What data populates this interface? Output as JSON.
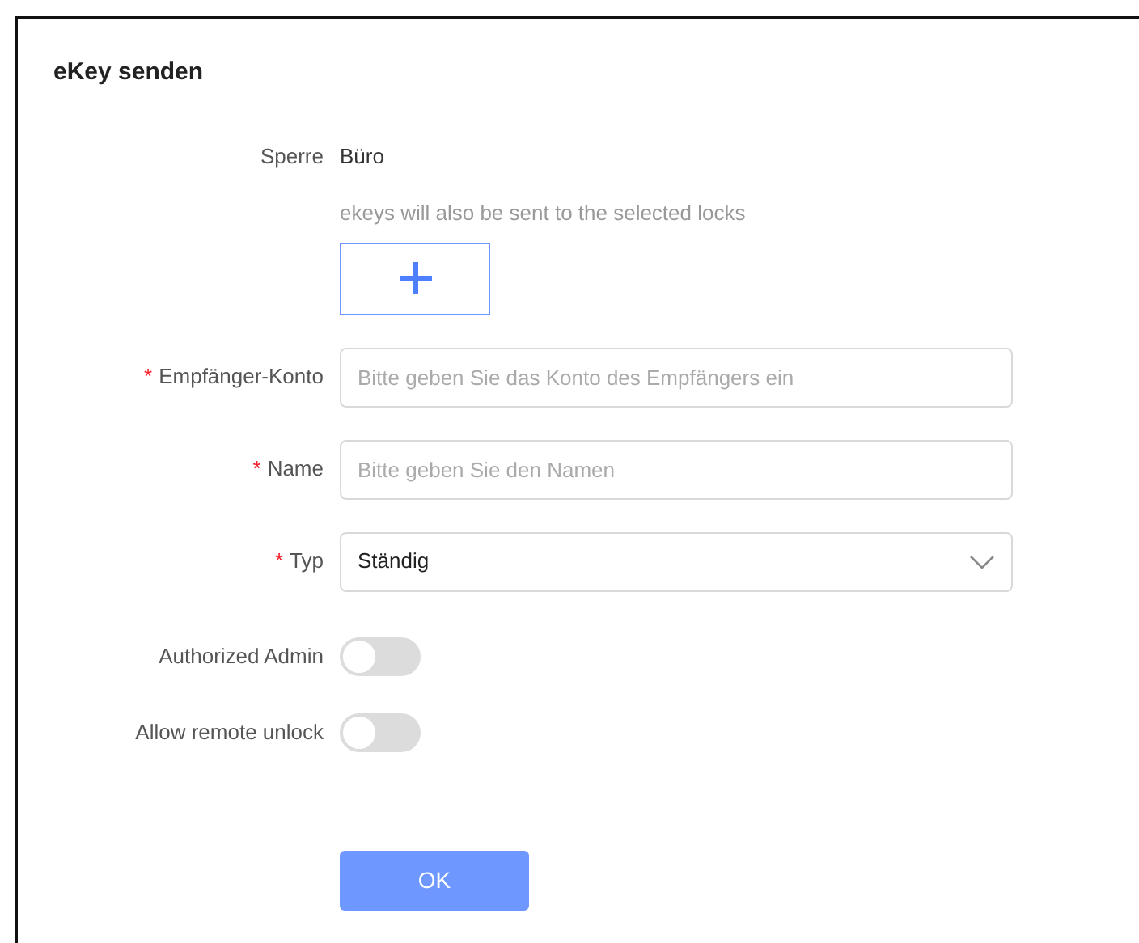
{
  "dialog": {
    "title": "eKey senden"
  },
  "lock": {
    "label": "Sperre",
    "value": "Büro",
    "hint": "ekeys will also be sent to the selected locks"
  },
  "fields": [
    {
      "kind": "input",
      "required_mark": "*",
      "label": "Empfänger-Konto",
      "placeholder": "Bitte geben Sie das Konto des Empfängers ein"
    },
    {
      "kind": "input",
      "required_mark": "*",
      "label": "Name",
      "placeholder": "Bitte geben Sie den Namen"
    },
    {
      "kind": "select",
      "required_mark": "*",
      "label": "Typ",
      "value": "Ständig"
    }
  ],
  "switches": [
    {
      "label": "Authorized Admin",
      "on": false
    },
    {
      "label": "Allow remote unlock",
      "on": false
    }
  ],
  "buttons": [
    "OK"
  ]
}
